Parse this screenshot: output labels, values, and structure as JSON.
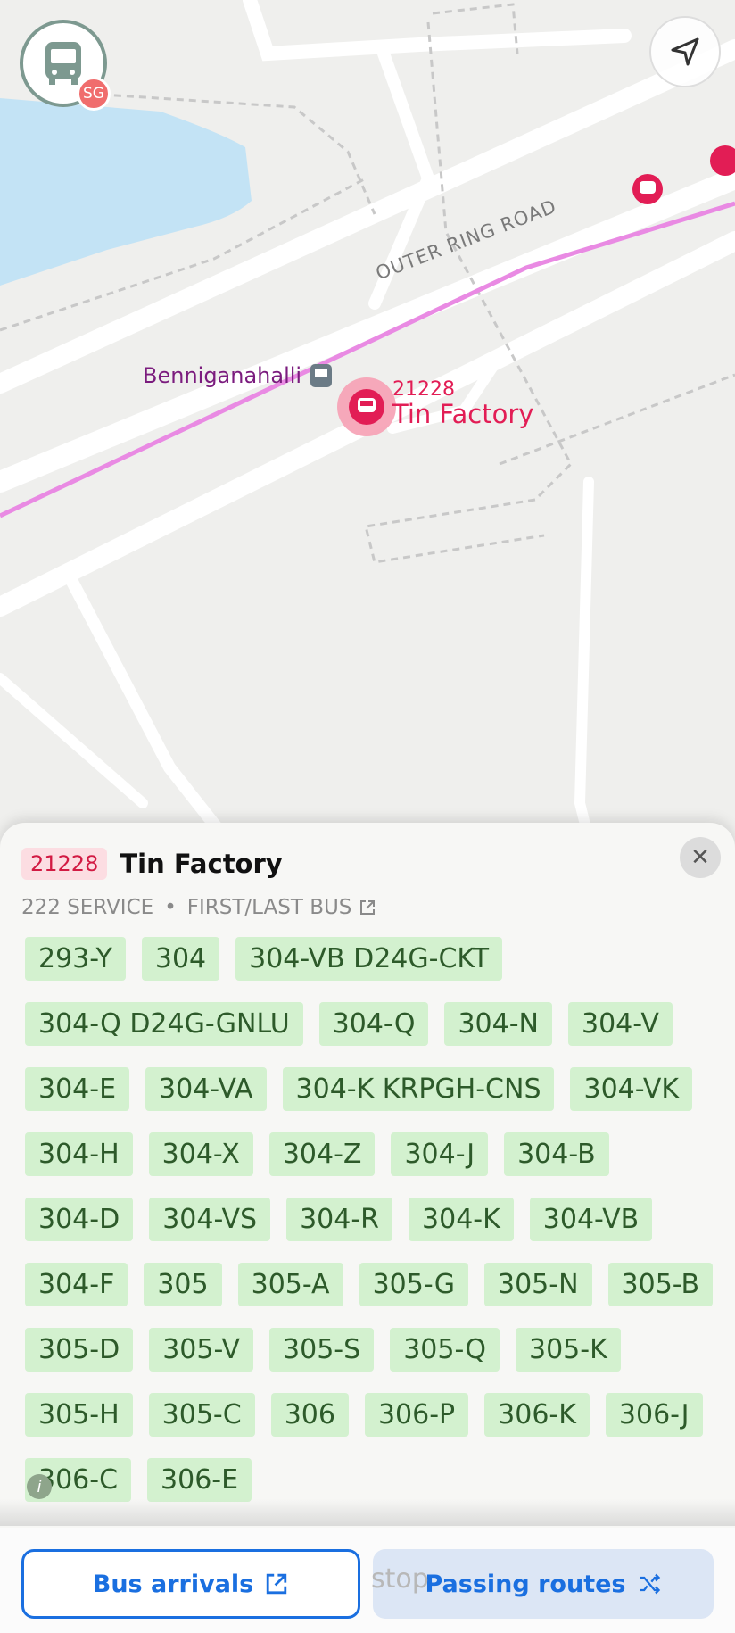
{
  "map": {
    "road_label": "OUTER RING ROAD",
    "place_label": "Benniganahalli",
    "selected_stop": {
      "code": "21228",
      "name": "Tin Factory"
    },
    "app_badge": "SG",
    "colors": {
      "route_line": "#e98ae3",
      "water": "#c3e3f5",
      "stop_red": "#e21d55",
      "road": "#ffffff"
    }
  },
  "sheet": {
    "code": "21228",
    "title": "Tin Factory",
    "service_count": "222 SERVICE",
    "separator": "•",
    "first_last_link": "FIRST/LAST BUS",
    "close_icon": "close-icon",
    "routes": [
      "293-Y",
      "304",
      "304-VB D24G-CKT",
      "304-Q D24G-GNLU",
      "304-Q",
      "304-N",
      "304-V",
      "304-E",
      "304-VA",
      "304-K KRPGH-CNS",
      "304-VK",
      "304-H",
      "304-X",
      "304-Z",
      "304-J",
      "304-B",
      "304-D",
      "304-VS",
      "304-R",
      "304-K",
      "304-VB",
      "304-F",
      "305",
      "305-A",
      "305-G",
      "305-N",
      "305-B",
      "305-D",
      "305-V",
      "305-S",
      "305-Q",
      "305-K",
      "305-H",
      "305-C",
      "306",
      "306-P",
      "306-K",
      "306-J",
      "306-C",
      "306-E"
    ]
  },
  "bottom": {
    "bus_arrivals_label": "Bus arrivals",
    "passing_routes_label": "Passing routes",
    "ghost_text": "stop",
    "info_symbol": "i"
  }
}
